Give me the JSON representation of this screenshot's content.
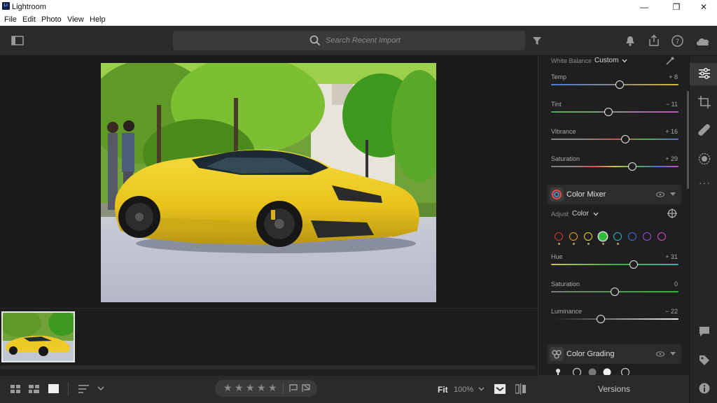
{
  "app": {
    "title": "Lightroom"
  },
  "menu": {
    "file": "File",
    "edit": "Edit",
    "photo": "Photo",
    "view": "View",
    "help": "Help"
  },
  "search": {
    "placeholder": "Search Recent Import"
  },
  "edit_panel": {
    "white_balance": {
      "label": "White Balance",
      "value": "Custom"
    },
    "sliders": [
      {
        "label": "Temp",
        "value": "+ 8",
        "position": 0.54
      },
      {
        "label": "Tint",
        "value": "− 11",
        "position": 0.45
      },
      {
        "label": "Vibrance",
        "value": "+ 16",
        "position": 0.58
      },
      {
        "label": "Saturation",
        "value": "+ 29",
        "position": 0.64
      }
    ],
    "color_mixer": {
      "title": "Color Mixer",
      "adjust_label": "Adjust",
      "adjust_value": "Color",
      "swatches": [
        "#e0332f",
        "#f09a20",
        "#e8d92a",
        "#2fbd3c",
        "#2db8bf",
        "#3b73e0",
        "#8a4ee8",
        "#d64bd1"
      ],
      "selected_swatch": 3,
      "sliders": [
        {
          "label": "Hue",
          "value": "+ 31",
          "position": 0.65
        },
        {
          "label": "Saturation",
          "value": "0",
          "position": 0.5
        },
        {
          "label": "Luminance",
          "value": "− 22",
          "position": 0.39
        }
      ]
    },
    "color_grading": {
      "title": "Color Grading"
    }
  },
  "bottom": {
    "fit": "Fit",
    "zoom": "100%",
    "versions": "Versions"
  },
  "rating": {
    "stars": 0,
    "max": 5
  }
}
